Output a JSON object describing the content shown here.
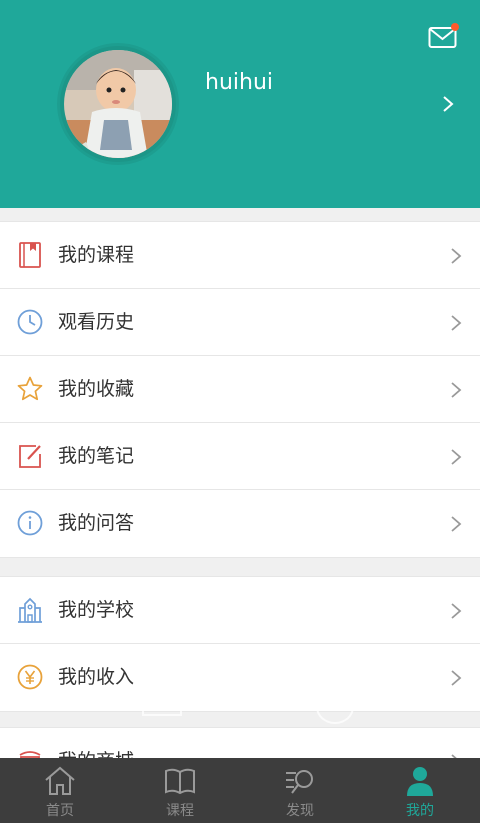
{
  "profile": {
    "username": "huihui",
    "avatar_alt": "child-photo",
    "has_unread_mail": true
  },
  "menu_groups": [
    {
      "items": [
        {
          "label": "我的课程",
          "icon": "book-bookmark-icon",
          "color": "#d9534f"
        },
        {
          "label": "观看历史",
          "icon": "clock-icon",
          "color": "#6f9fd8"
        },
        {
          "label": "我的收藏",
          "icon": "star-icon",
          "color": "#e8a23a"
        },
        {
          "label": "我的笔记",
          "icon": "edit-icon",
          "color": "#d9534f"
        },
        {
          "label": "我的问答",
          "icon": "info-icon",
          "color": "#6f9fd8"
        }
      ]
    },
    {
      "items": [
        {
          "label": "我的学校",
          "icon": "school-icon",
          "color": "#6f9fd8"
        },
        {
          "label": "我的收入",
          "icon": "yen-coin-icon",
          "color": "#e8a23a"
        }
      ]
    },
    {
      "items": [
        {
          "label": "我的商城",
          "icon": "shop-icon",
          "color": "#d9534f"
        }
      ]
    }
  ],
  "tabs": [
    {
      "label": "首页",
      "icon": "home-icon",
      "active": false
    },
    {
      "label": "课程",
      "icon": "open-book-icon",
      "active": false
    },
    {
      "label": "发现",
      "icon": "discover-search-icon",
      "active": false
    },
    {
      "label": "我的",
      "icon": "user-icon",
      "active": true
    }
  ],
  "colors": {
    "brand": "#1fa89a",
    "tabbar": "#3d3d3d",
    "notification": "#ff5a2b"
  }
}
